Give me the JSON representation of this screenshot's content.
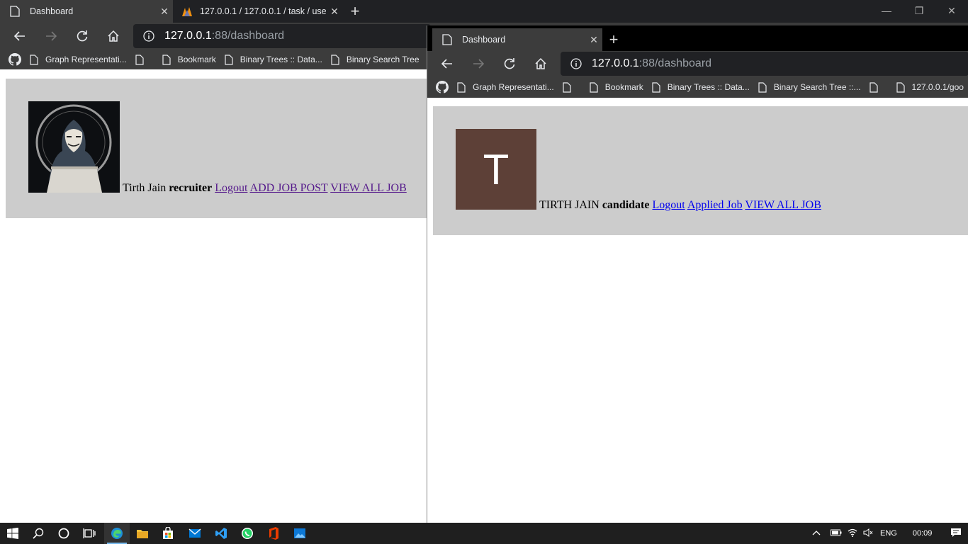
{
  "window_left": {
    "tabs": [
      {
        "label": "Dashboard",
        "active": true
      },
      {
        "label": "127.0.0.1 / 127.0.0.1 / task / user",
        "active": false
      }
    ],
    "url": {
      "host": "127.0.0.1",
      "rest": ":88/dashboard"
    },
    "bookmarks": [
      "Graph Representati...",
      "Bookmark",
      "Binary Trees :: Data...",
      "Binary Search Tree"
    ],
    "profile": {
      "name": "Tirth Jain",
      "role": "recruiter",
      "links": [
        "Logout",
        "ADD JOB POST",
        "VIEW ALL JOB"
      ]
    }
  },
  "window_right": {
    "tabs": [
      {
        "label": "Dashboard",
        "active": true
      }
    ],
    "url": {
      "host": "127.0.0.1",
      "rest": ":88/dashboard"
    },
    "bookmarks": [
      "Graph Representati...",
      "Bookmark",
      "Binary Trees :: Data...",
      "Binary Search Tree ::...",
      "127.0.0.1/goo"
    ],
    "profile": {
      "avatar_letter": "T",
      "avatar_color": "#5d4037",
      "name": "TIRTH JAIN",
      "role": "candidate",
      "links": [
        "Logout",
        "Applied Job",
        "VIEW ALL JOB"
      ]
    }
  },
  "taskbar": {
    "apps": [
      "start-icon",
      "search-icon",
      "cortana-icon",
      "task-view-icon",
      "edge-icon",
      "file-explorer-icon",
      "store-icon",
      "mail-icon",
      "vscode-icon",
      "whatsapp-icon",
      "office-icon",
      "photos-icon"
    ],
    "language": "ENG",
    "time": "00:09"
  }
}
